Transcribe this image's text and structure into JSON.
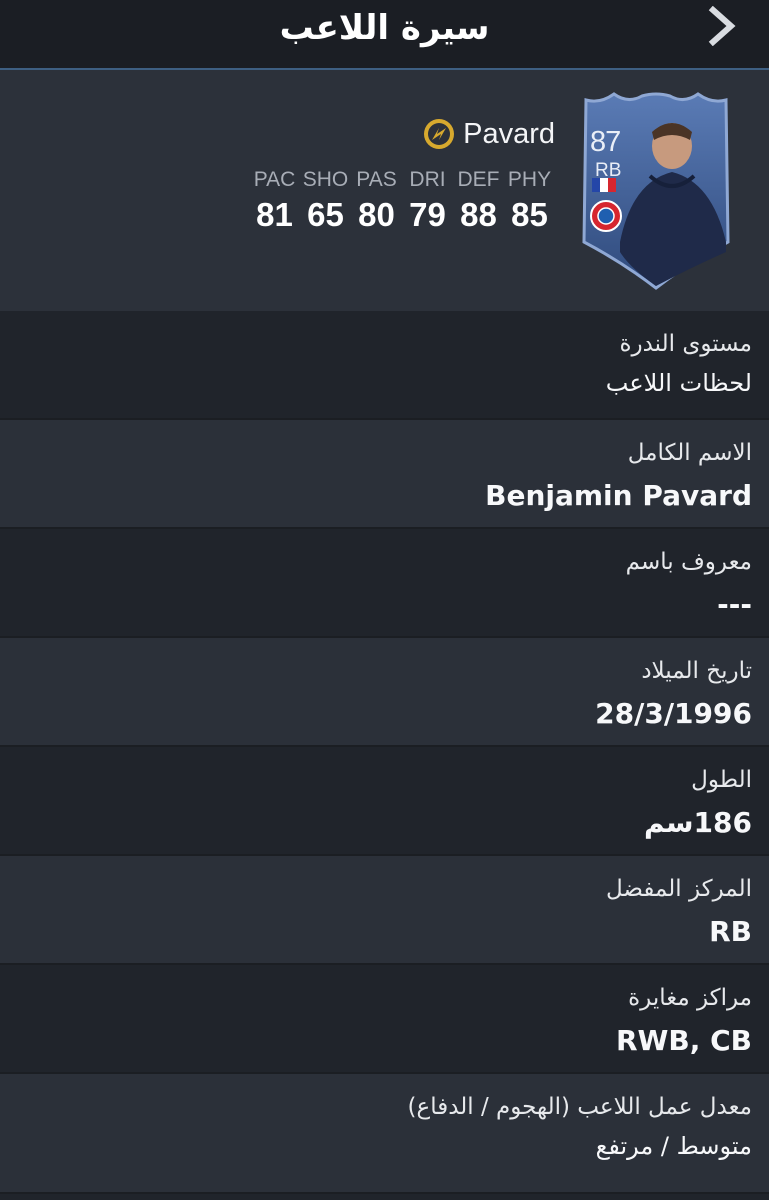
{
  "header": {
    "title": "سيرة اللاعب",
    "back_icon": "chevron-right-icon"
  },
  "player": {
    "name": "Pavard",
    "rating": "87",
    "position": "RB",
    "chemistry_icon": "chemistry-style-icon",
    "card_color": "#3f5f95",
    "accent_color": "#d7a92e",
    "stats": [
      {
        "label": "PAC",
        "value": "81"
      },
      {
        "label": "SHO",
        "value": "65"
      },
      {
        "label": "PAS",
        "value": "80"
      },
      {
        "label": "DRI",
        "value": "79"
      },
      {
        "label": "DEF",
        "value": "88"
      },
      {
        "label": "PHY",
        "value": "85"
      }
    ]
  },
  "info": [
    {
      "label": "مستوى الندرة",
      "value": "لحظات اللاعب"
    },
    {
      "label": "الاسم الكامل",
      "value": "Benjamin Pavard"
    },
    {
      "label": "معروف باسم",
      "value": "---"
    },
    {
      "label": "تاريخ الميلاد",
      "value": "28/3/1996"
    },
    {
      "label": "الطول",
      "value": "186سم"
    },
    {
      "label": "المركز المفضل",
      "value": "RB"
    },
    {
      "label": "مراكز مغايرة",
      "value": "RWB, CB"
    },
    {
      "label": "معدل عمل اللاعب (الهجوم / الدفاع)",
      "value": "متوسط / مرتفع"
    }
  ]
}
